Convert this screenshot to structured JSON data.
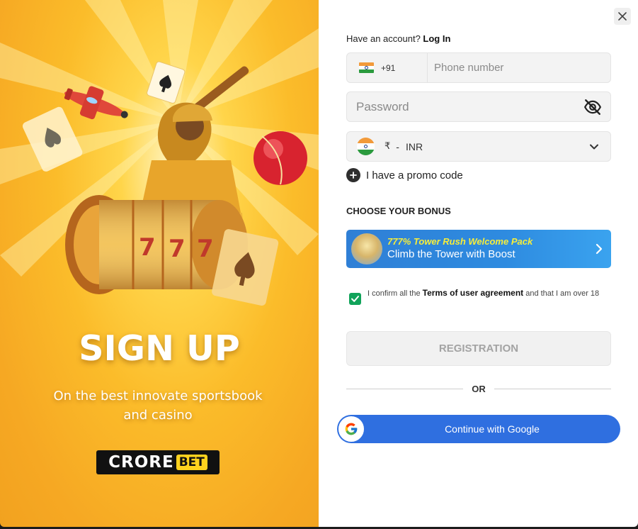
{
  "promo": {
    "title": "SIGN UP",
    "subtitle": "On the best innovate sportsbook and casino",
    "logo": {
      "part1": "CRORE",
      "part2": "BET"
    },
    "accent_color": "#fbbc2a"
  },
  "form": {
    "close_icon": "close-icon",
    "have_account": "Have an account?",
    "login_link": "Log In",
    "phone": {
      "country_code": "+91",
      "placeholder": "Phone number",
      "flag_icon": "india-flag-icon"
    },
    "password": {
      "placeholder": "Password",
      "toggle_icon": "eye-slash-icon"
    },
    "currency": {
      "symbol": "₹",
      "separator": "-",
      "code": "INR",
      "dropdown_icon": "chevron-down-icon"
    },
    "promo_code_label": "I have a promo code",
    "bonus_section_title": "CHOOSE YOUR BONUS",
    "bonus": {
      "title": "777% Tower Rush Welcome Pack",
      "subtitle": "Climb the Tower with Boost",
      "arrow_icon": "chevron-right-icon",
      "title_color": "#f7ee3a",
      "bg_color": "#2f7fd6"
    },
    "agreement": {
      "checked": true,
      "prefix": "I confirm all the",
      "link": "Terms of user agreement",
      "suffix": "and that I am over 18"
    },
    "register_label": "REGISTRATION",
    "or_label": "OR",
    "google_label": "Continue with Google",
    "google_color": "#2f6fe0",
    "check_color": "#11a35a"
  }
}
